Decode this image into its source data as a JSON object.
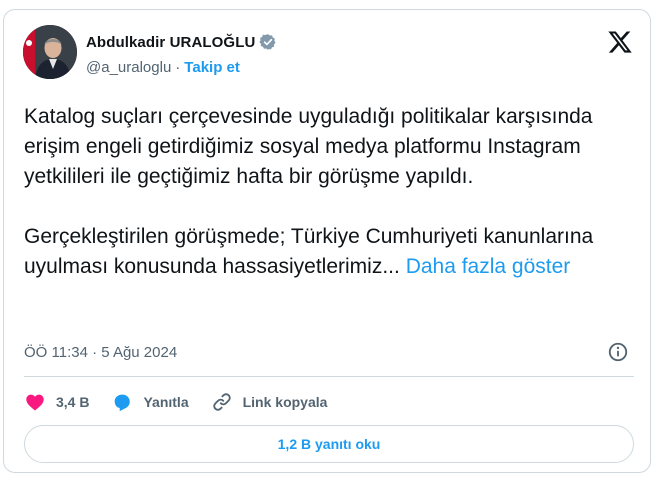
{
  "author": {
    "name": "Abdulkadir URALOĞLU",
    "handle": "@a_uraloglu",
    "separator": "·",
    "follow_label": "Takip et"
  },
  "tweet": {
    "paragraph1": "Katalog suçları çerçevesinde uyguladığı politikalar karşısında erişim engeli getirdiğimiz sosyal medya platformu Instagram yetkilileri ile geçtiğimiz hafta bir görüşme yapıldı.",
    "paragraph2": "Gerçekleştirilen görüşmede; Türkiye Cumhuriyeti kanunlarına uyulması konusunda hassasiyetlerimiz...",
    "show_more": "Daha fazla göster",
    "timestamp": "ÖÖ 11:34 · 5 Ağu 2024"
  },
  "actions": {
    "likes": "3,4 B",
    "reply": "Yanıtla",
    "copy_link": "Link kopyala"
  },
  "replies_button": "1,2 B yanıtı oku",
  "colors": {
    "accent": "#1d9bf0",
    "like": "#f91880",
    "muted": "#536471",
    "border": "#cfd9de"
  },
  "icons": [
    "verified-badge-icon",
    "x-logo-icon",
    "info-icon",
    "heart-icon",
    "reply-bubble-icon",
    "link-icon"
  ]
}
